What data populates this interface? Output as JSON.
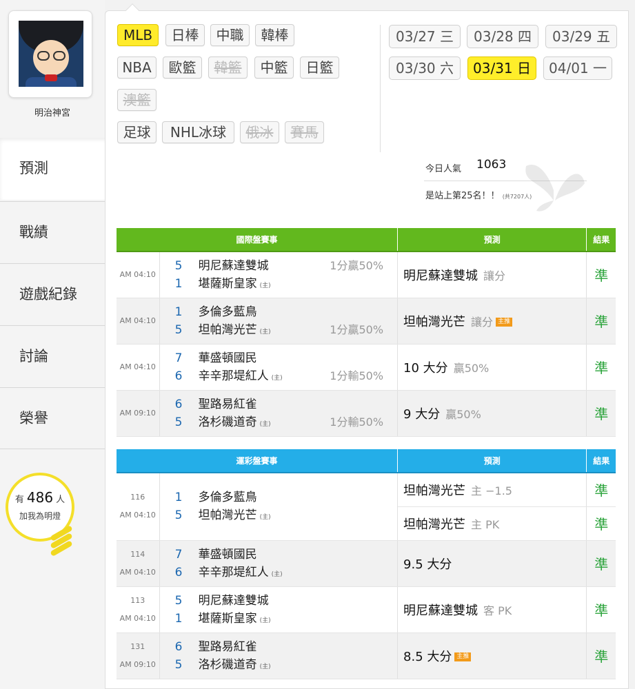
{
  "user": {
    "name": "明治神宮"
  },
  "nav": [
    "預測",
    "戰績",
    "遊戲紀錄",
    "討論",
    "榮譽"
  ],
  "fans": {
    "prefix": "有",
    "count": "486",
    "suffix": "人",
    "line2": "加我為明燈"
  },
  "sports": [
    {
      "label": "MLB",
      "state": "on"
    },
    {
      "label": "日棒",
      "state": "normal"
    },
    {
      "label": "中職",
      "state": "normal"
    },
    {
      "label": "韓棒",
      "state": "normal"
    },
    {
      "label": "NBA",
      "state": "normal"
    },
    {
      "label": "歐籃",
      "state": "normal"
    },
    {
      "label": "韓籃",
      "state": "off"
    },
    {
      "label": "中籃",
      "state": "normal"
    },
    {
      "label": "日籃",
      "state": "normal"
    },
    {
      "label": "澳籃",
      "state": "off"
    },
    {
      "label": "足球",
      "state": "normal"
    },
    {
      "label": "NHL冰球",
      "state": "normal"
    },
    {
      "label": "俄冰",
      "state": "off"
    },
    {
      "label": "賽馬",
      "state": "off"
    }
  ],
  "dates": [
    {
      "label": "03/27 三",
      "active": false
    },
    {
      "label": "03/28 四",
      "active": false
    },
    {
      "label": "03/29 五",
      "active": false
    },
    {
      "label": "03/30 六",
      "active": false
    },
    {
      "label": "03/31 日",
      "active": true
    },
    {
      "label": "04/01 一",
      "active": false
    }
  ],
  "popularity": {
    "label": "今日人氣",
    "value": "1063",
    "rank_text": "是站上第25名！！",
    "total": "(共7207人)"
  },
  "intl": {
    "headers": [
      "國際盤賽事",
      "預測",
      "結果"
    ],
    "rows": [
      {
        "time": "AM 04:10",
        "t1": "明尼蘇達雙城",
        "s1": "5",
        "t2": "堪薩斯皇家",
        "s2": "1",
        "host": "(主)",
        "odds_row": 1,
        "odds": "1分贏50%",
        "pick": "明尼蘇達雙城",
        "pick_sub": "讓分",
        "tag": "",
        "result": "準"
      },
      {
        "time": "AM 04:10",
        "t1": "多倫多藍鳥",
        "s1": "1",
        "t2": "坦帕灣光芒",
        "s2": "5",
        "host": "(主)",
        "odds_row": 2,
        "odds": "1分贏50%",
        "pick": "坦帕灣光芒",
        "pick_sub": "讓分",
        "tag": "主推",
        "result": "準"
      },
      {
        "time": "AM 04:10",
        "t1": "華盛頓國民",
        "s1": "7",
        "t2": "辛辛那堤紅人",
        "s2": "6",
        "host": "(主)",
        "odds_row": 2,
        "odds": "1分輸50%",
        "pick": "10 大分",
        "pick_sub": "贏50%",
        "tag": "",
        "result": "準"
      },
      {
        "time": "AM 09:10",
        "t1": "聖路易紅雀",
        "s1": "6",
        "t2": "洛杉磯道奇",
        "s2": "5",
        "host": "(主)",
        "odds_row": 2,
        "odds": "1分輸50%",
        "pick": "9 大分",
        "pick_sub": "贏50%",
        "tag": "",
        "result": "準"
      }
    ]
  },
  "lottery": {
    "headers": [
      "運彩盤賽事",
      "預測",
      "結果"
    ],
    "rows": [
      {
        "num": "116",
        "time": "AM 04:10",
        "t1": "多倫多藍鳥",
        "s1": "1",
        "t2": "坦帕灣光芒",
        "s2": "5",
        "host": "(主)",
        "picks": [
          {
            "pick": "坦帕灣光芒",
            "sub": "主 −1.5",
            "tag": "",
            "result": "準"
          },
          {
            "pick": "坦帕灣光芒",
            "sub": "主 PK",
            "tag": "",
            "result": "準"
          }
        ]
      },
      {
        "num": "114",
        "time": "AM 04:10",
        "t1": "華盛頓國民",
        "s1": "7",
        "t2": "辛辛那堤紅人",
        "s2": "6",
        "host": "(主)",
        "picks": [
          {
            "pick": "9.5 大分",
            "sub": "",
            "tag": "",
            "result": "準"
          }
        ]
      },
      {
        "num": "113",
        "time": "AM 04:10",
        "t1": "明尼蘇達雙城",
        "s1": "5",
        "t2": "堪薩斯皇家",
        "s2": "1",
        "host": "(主)",
        "picks": [
          {
            "pick": "明尼蘇達雙城",
            "sub": "客 PK",
            "tag": "",
            "result": "準"
          }
        ]
      },
      {
        "num": "131",
        "time": "AM 09:10",
        "t1": "聖路易紅雀",
        "s1": "6",
        "t2": "洛杉磯道奇",
        "s2": "5",
        "host": "(主)",
        "picks": [
          {
            "pick": "8.5 大分",
            "sub": "",
            "tag": "主推",
            "result": "準"
          }
        ]
      }
    ]
  }
}
